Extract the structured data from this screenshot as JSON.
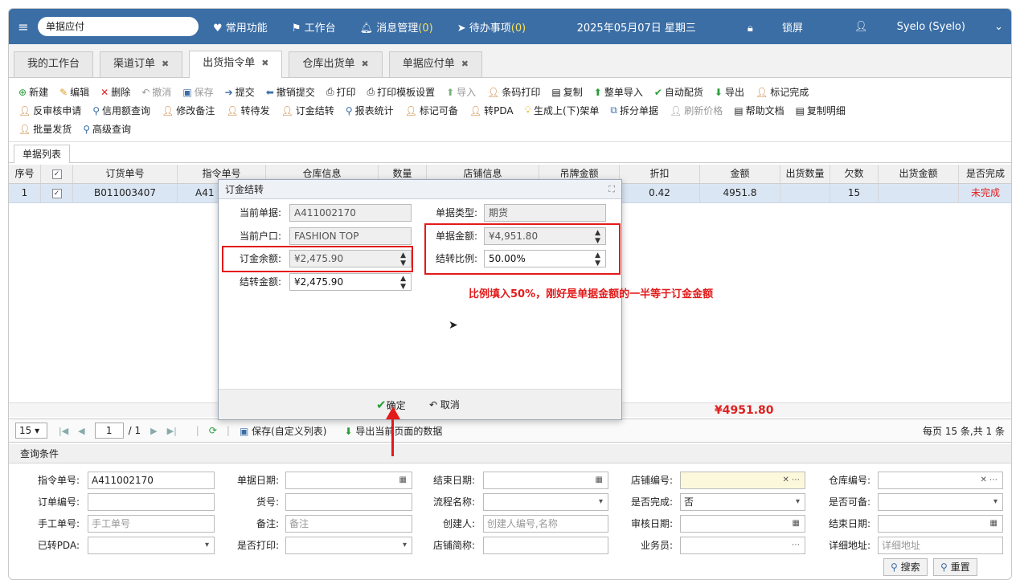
{
  "topbar": {
    "search_value": "单据应付",
    "nav": [
      {
        "label": "常用功能",
        "icon": "heart-icon"
      },
      {
        "label": "工作台",
        "icon": "flag-icon"
      },
      {
        "label": "消息管理",
        "count": "(0)",
        "icon": "bell-icon"
      },
      {
        "label": "待办事项",
        "count": "(0)",
        "icon": "send-icon"
      }
    ],
    "date": "2025年05月07日 星期三",
    "lock": "锁屏",
    "user": "Syelo (Syelo)"
  },
  "tabs": [
    {
      "label": "我的工作台",
      "closable": false
    },
    {
      "label": "渠道订单",
      "closable": true
    },
    {
      "label": "出货指令单",
      "closable": true,
      "active": true
    },
    {
      "label": "仓库出货单",
      "closable": true
    },
    {
      "label": "单据应付单",
      "closable": true
    }
  ],
  "toolbar": {
    "row1": [
      "新建",
      "编辑",
      "删除",
      "撤消",
      "保存",
      "提交",
      "撤销提交",
      "打印",
      "打印模板设置",
      "导入",
      "条码打印",
      "复制",
      "整单导入",
      "自动配货",
      "导出",
      "标记完成"
    ],
    "row2": [
      "反审核申请",
      "信用额查询",
      "修改备注",
      "转待发",
      "订金结转",
      "报表统计",
      "标记可备",
      "转PDA",
      "生成上(下)架单",
      "拆分单据",
      "刷新价格",
      "帮助文档",
      "复制明细"
    ],
    "row3": [
      "批量发货",
      "高级查询"
    ]
  },
  "list_tab": "单据列表",
  "grid": {
    "headers": [
      "序号",
      "",
      "订货单号",
      "指令单号",
      "仓库信息",
      "数量",
      "店铺信息",
      "吊牌金额",
      "折扣",
      "金额",
      "出货数量",
      "欠数",
      "出货金额",
      "是否完成"
    ],
    "row": {
      "seq": "1",
      "order_no": "B011003407",
      "cmd_no": "A41",
      "discount": "0.42",
      "amount": "4951.8",
      "owe": "15",
      "status": "未完成"
    },
    "total": "¥4951.80"
  },
  "pager": {
    "page_size": "15",
    "page": "1",
    "total_pages": "/ 1",
    "save_label": "保存(自定义列表)",
    "export_label": "导出当前页面的数据",
    "info": "每页 15 条,共 1 条"
  },
  "query": {
    "title": "查询条件",
    "cmd_no_label": "指令单号:",
    "cmd_no": "A411002170",
    "bill_date_label": "单据日期:",
    "end_date_label": "结束日期:",
    "shop_no_label": "店铺编号:",
    "warehouse_no_label": "仓库编号:",
    "order_no_label": "订单编号:",
    "goods_no_label": "货号:",
    "flow_name_label": "流程名称:",
    "finished_label": "是否完成:",
    "finished": "否",
    "prepared_label": "是否可备:",
    "manual_no_label": "手工单号:",
    "manual_no_ph": "手工单号",
    "remark_label": "备注:",
    "remark_ph": "备注",
    "creator_label": "创建人:",
    "creator_ph": "创建人编号,名称",
    "audit_date_label": "审核日期:",
    "end_date2_label": "结束日期:",
    "pda_label": "已转PDA:",
    "printed_label": "是否打印:",
    "shop_abbr_label": "店铺简称:",
    "salesman_label": "业务员:",
    "address_label": "详细地址:",
    "address_ph": "详细地址",
    "search_btn": "搜索",
    "reset_btn": "重置"
  },
  "dialog": {
    "title": "订金结转",
    "cur_bill_label": "当前单据:",
    "cur_bill": "A411002170",
    "bill_type_label": "单据类型:",
    "bill_type": "期货",
    "cur_account_label": "当前户口:",
    "cur_account": "FASHION TOP",
    "bill_amount_label": "单据金额:",
    "bill_amount": "¥4,951.80",
    "deposit_label": "订金余额:",
    "deposit": "¥2,475.90",
    "ratio_label": "结转比例:",
    "ratio": "50.00%",
    "carry_label": "结转金额:",
    "carry": "¥2,475.90",
    "ok": "确定",
    "cancel": "取消"
  },
  "annotation": "比例填入50%，刚好是单据金额的一半等于订金金额",
  "colors": {
    "topbar": "#3b6ea5",
    "highlight": "#e31a1a",
    "selected_row": "#dbe6f4"
  }
}
